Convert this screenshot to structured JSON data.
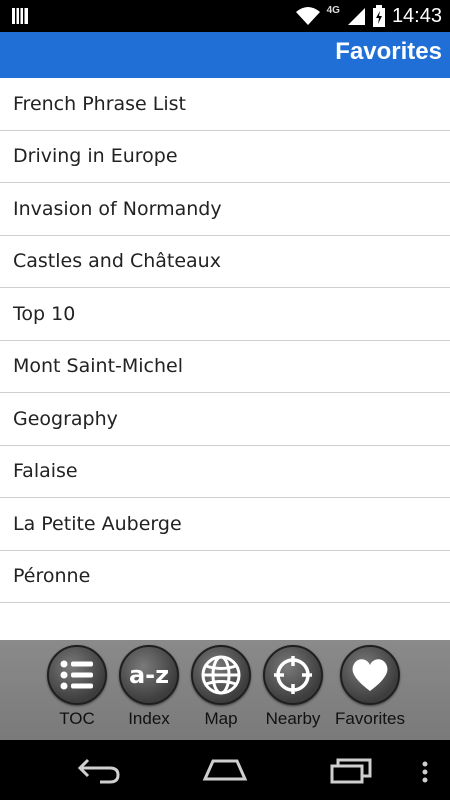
{
  "status_bar": {
    "network": "4G",
    "time": "14:43"
  },
  "header": {
    "title": "Favorites"
  },
  "favorites": [
    "French Phrase List",
    "Driving in Europe",
    "Invasion of Normandy",
    "Castles and Châteaux",
    "Top 10",
    "Mont Saint-Michel",
    "Geography",
    "Falaise",
    "La Petite Auberge",
    "Péronne"
  ],
  "toolbar": {
    "items": [
      {
        "label": "TOC",
        "icon": "list-icon"
      },
      {
        "label": "Index",
        "icon": "a-z-icon",
        "glyph": "a-z"
      },
      {
        "label": "Map",
        "icon": "globe-icon"
      },
      {
        "label": "Nearby",
        "icon": "crosshair-icon"
      },
      {
        "label": "Favorites",
        "icon": "heart-icon"
      }
    ]
  },
  "nav_bar": {
    "buttons": [
      "back-icon",
      "home-icon",
      "recent-apps-icon",
      "overflow-menu-icon"
    ]
  }
}
